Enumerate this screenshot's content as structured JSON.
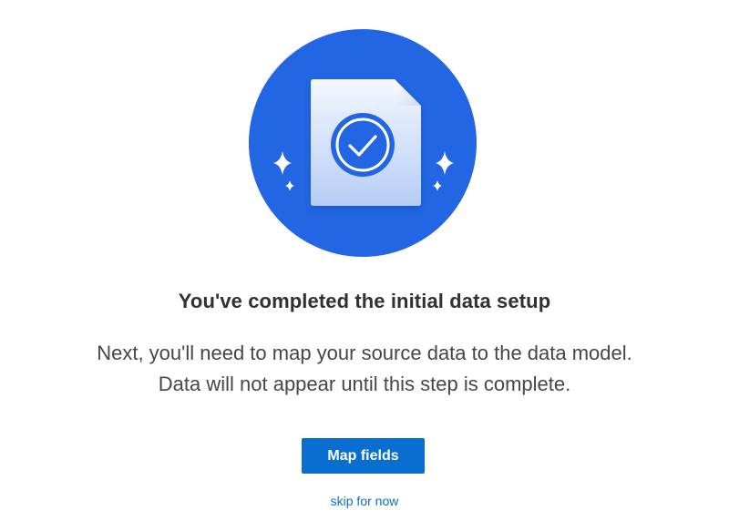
{
  "hero": {
    "icon": "document-check-icon",
    "circle_color": "#2266e3",
    "sparkle_icon": "sparkle-icon"
  },
  "content": {
    "title": "You've completed the initial data setup",
    "description_line1": "Next, you'll need to map your source data to the data model.",
    "description_line2": "Data will not appear until this step is complete."
  },
  "actions": {
    "primary_label": "Map fields",
    "primary_color": "#0a6ed1",
    "skip_label": "skip for now"
  }
}
